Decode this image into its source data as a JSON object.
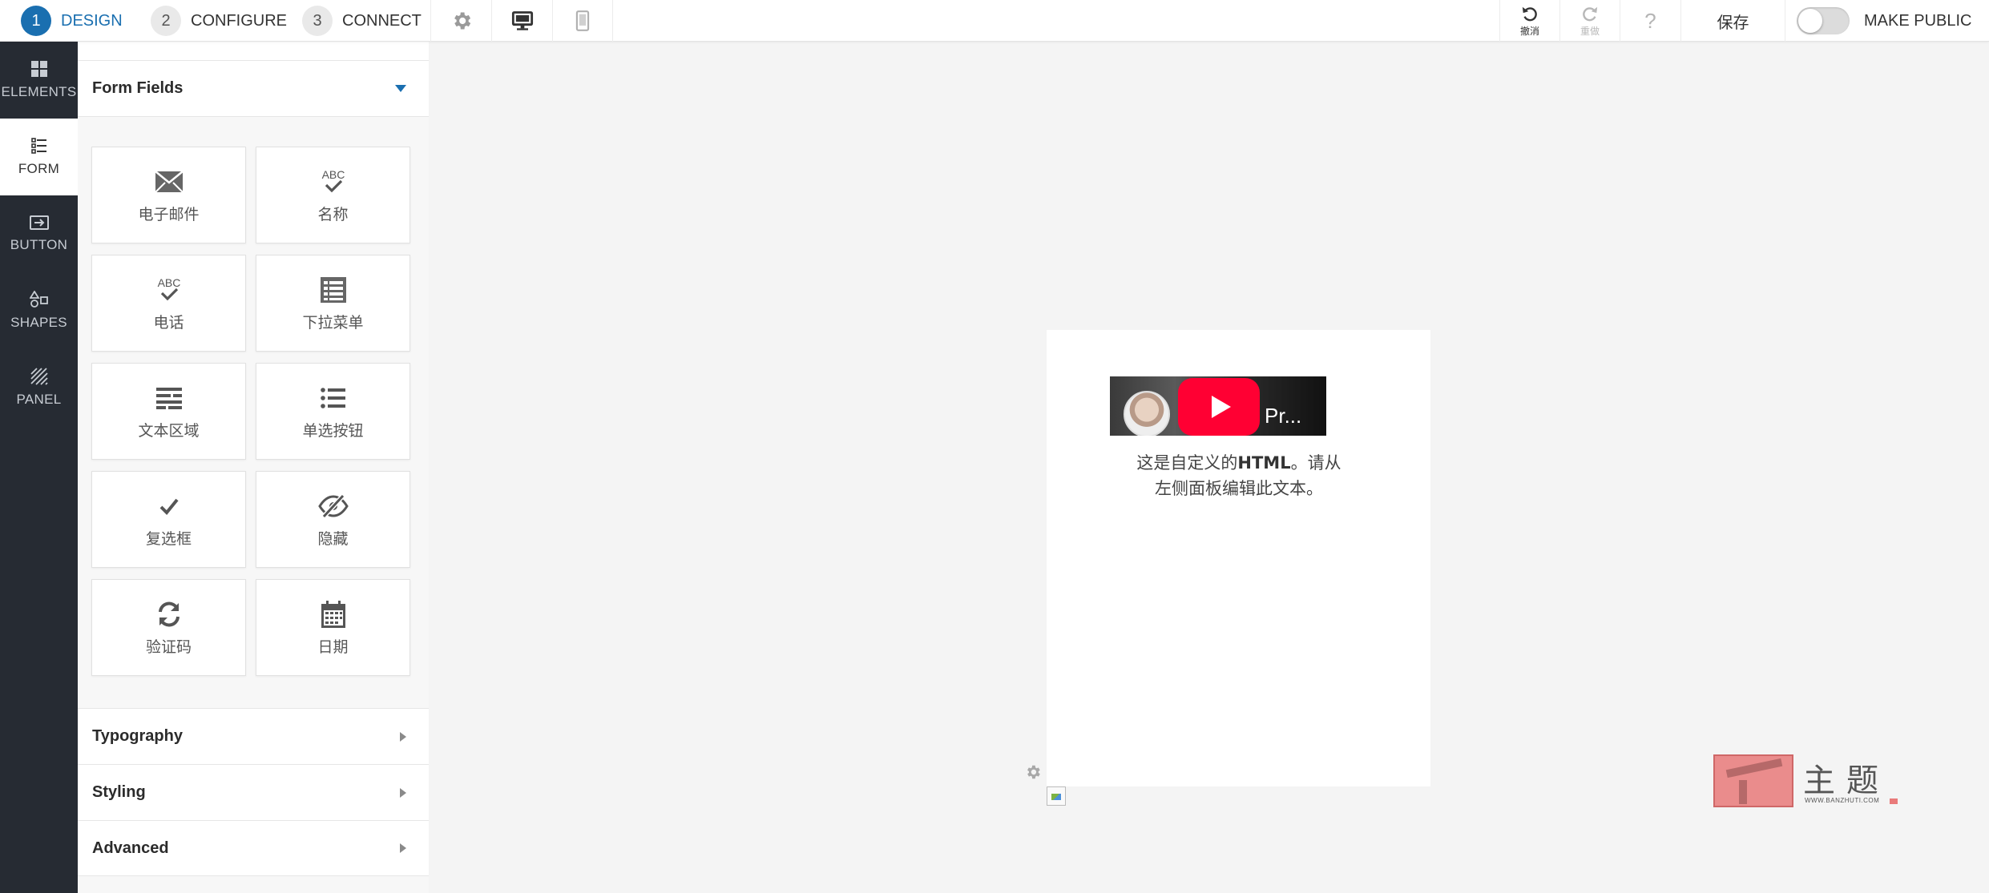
{
  "topbar": {
    "steps": [
      {
        "num": "1",
        "label": "DESIGN",
        "active": true
      },
      {
        "num": "2",
        "label": "CONFIGURE",
        "active": false
      },
      {
        "num": "3",
        "label": "CONNECT",
        "active": false
      }
    ],
    "undo_label": "撤消",
    "redo_label": "重做",
    "help_label": "?",
    "save_label": "保存",
    "make_public_label": "MAKE PUBLIC",
    "make_public_on": false,
    "accent_color": "#1a6fb0"
  },
  "rail": {
    "items": [
      {
        "label": "ELEMENTS",
        "icon": "grid-icon",
        "active": false
      },
      {
        "label": "FORM",
        "icon": "form-list-icon",
        "active": true
      },
      {
        "label": "BUTTON",
        "icon": "button-icon",
        "active": false
      },
      {
        "label": "SHAPES",
        "icon": "shapes-icon",
        "active": false
      },
      {
        "label": "PANEL",
        "icon": "panel-icon",
        "active": false
      }
    ]
  },
  "panel": {
    "form_fields_title": "Form Fields",
    "fields": [
      {
        "label": "电子邮件",
        "icon": "envelope-icon"
      },
      {
        "label": "名称",
        "icon": "abc-check-icon"
      },
      {
        "label": "电话",
        "icon": "abc-check-icon"
      },
      {
        "label": "下拉菜单",
        "icon": "list-table-icon"
      },
      {
        "label": "文本区域",
        "icon": "text-lines-icon"
      },
      {
        "label": "单选按钮",
        "icon": "bullet-list-icon"
      },
      {
        "label": "复选框",
        "icon": "checkmark-icon"
      },
      {
        "label": "隐藏",
        "icon": "eye-slash-icon"
      },
      {
        "label": "验证码",
        "icon": "refresh-icon"
      },
      {
        "label": "日期",
        "icon": "calendar-icon"
      }
    ],
    "accordions": [
      {
        "label": "Typography"
      },
      {
        "label": "Styling"
      },
      {
        "label": "Advanced"
      }
    ]
  },
  "canvas": {
    "video_title": "Pr...",
    "html_text_prefix": "这是自定义的",
    "html_text_bold": "HTML",
    "html_text_suffix": "。请从左侧面板编辑此文本。"
  },
  "watermark": {
    "chars": "主题",
    "url": "WWW.BANZHUTI.COM"
  }
}
